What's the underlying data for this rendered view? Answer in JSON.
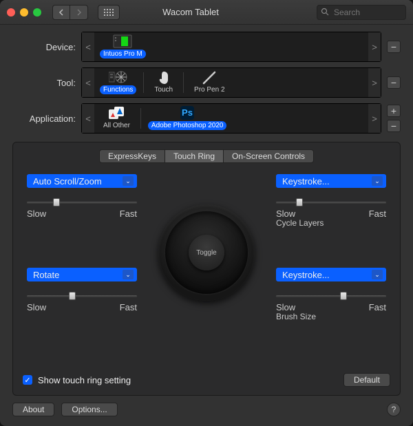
{
  "window": {
    "title": "Wacom Tablet"
  },
  "search": {
    "placeholder": "Search"
  },
  "selectors": {
    "device": {
      "label": "Device:",
      "selected": "Intuos Pro M"
    },
    "tool": {
      "label": "Tool:",
      "items": [
        {
          "name": "Functions",
          "selected": true
        },
        {
          "name": "Touch",
          "selected": false
        },
        {
          "name": "Pro Pen 2",
          "selected": false
        }
      ]
    },
    "application": {
      "label": "Application:",
      "items": [
        {
          "name": "All Other",
          "selected": false
        },
        {
          "name": "Adobe Photoshop 2020",
          "selected": true
        }
      ]
    }
  },
  "tabs": [
    {
      "label": "ExpressKeys",
      "active": false
    },
    {
      "label": "Touch Ring",
      "active": true
    },
    {
      "label": "On-Screen Controls",
      "active": false
    }
  ],
  "touchring": {
    "toggle_label": "Toggle",
    "quads": {
      "tl": {
        "function": "Auto Scroll/Zoom",
        "slow": "Slow",
        "fast": "Fast",
        "slider_pct": 24,
        "desc": ""
      },
      "tr": {
        "function": "Keystroke...",
        "slow": "Slow",
        "fast": "Fast",
        "slider_pct": 18,
        "desc": "Cycle Layers"
      },
      "bl": {
        "function": "Rotate",
        "slow": "Slow",
        "fast": "Fast",
        "slider_pct": 38,
        "desc": ""
      },
      "br": {
        "function": "Keystroke...",
        "slow": "Slow",
        "fast": "Fast",
        "slider_pct": 58,
        "desc": "Brush Size"
      }
    },
    "show_setting": {
      "checked": true,
      "label": "Show touch ring setting"
    },
    "default_btn": "Default"
  },
  "footer": {
    "about": "About",
    "options": "Options...",
    "help": "?"
  }
}
